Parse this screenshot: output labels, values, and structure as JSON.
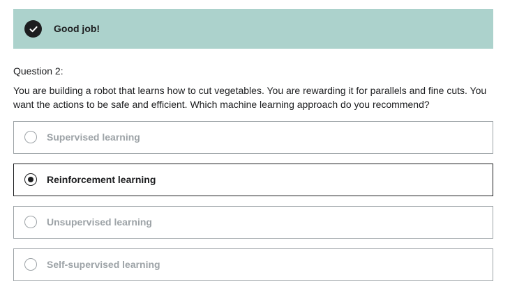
{
  "feedback": {
    "icon": "check-circle-icon",
    "message": "Good job!",
    "background_color": "#acd2cc"
  },
  "question": {
    "label": "Question 2:",
    "text": "You are building a robot that learns how to cut vegetables. You are rewarding it for parallels and fine cuts. You want the actions to be safe and efficient. Which machine learning approach do you recommend?"
  },
  "options": [
    {
      "label": "Supervised learning",
      "selected": false
    },
    {
      "label": "Reinforcement learning",
      "selected": true
    },
    {
      "label": "Unsupervised learning",
      "selected": false
    },
    {
      "label": "Self-supervised learning",
      "selected": false
    }
  ]
}
